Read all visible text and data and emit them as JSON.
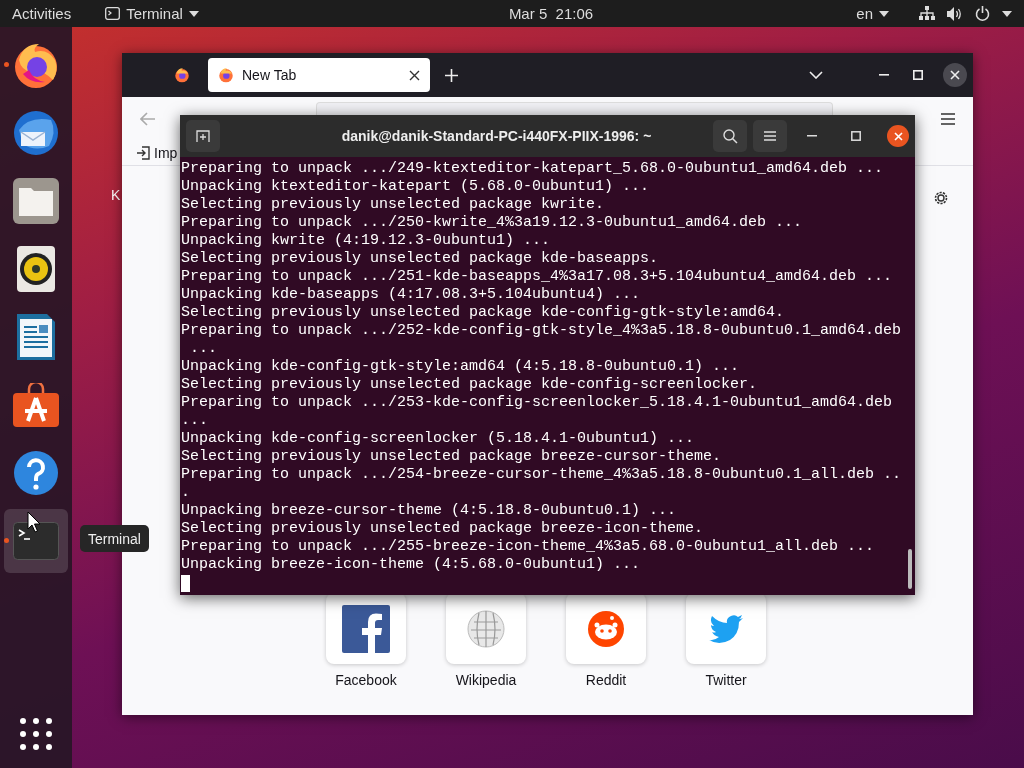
{
  "top_bar": {
    "activities": "Activities",
    "app_menu": "Terminal",
    "clock": "Mar 5  21:06",
    "input_source": "en"
  },
  "dock": {
    "items": [
      {
        "kind": "firefox",
        "running": true,
        "selected": false
      },
      {
        "kind": "thunderbird",
        "running": false,
        "selected": false
      },
      {
        "kind": "files",
        "running": false,
        "selected": false
      },
      {
        "kind": "rhythmbox",
        "running": false,
        "selected": false
      },
      {
        "kind": "writer",
        "running": false,
        "selected": false
      },
      {
        "kind": "software",
        "running": false,
        "selected": false
      },
      {
        "kind": "help",
        "running": false,
        "selected": false
      },
      {
        "kind": "terminal",
        "running": true,
        "selected": true
      }
    ],
    "tooltip": "Terminal"
  },
  "desktop_label": "K",
  "browser": {
    "tabs": [
      {
        "title": "New Tab",
        "selected": true
      }
    ],
    "bookmark": "Imp",
    "shortcuts": [
      {
        "label": "Facebook",
        "kind": "facebook"
      },
      {
        "label": "Wikipedia",
        "kind": "wikipedia"
      },
      {
        "label": "Reddit",
        "kind": "reddit"
      },
      {
        "label": "Twitter",
        "kind": "twitter"
      }
    ]
  },
  "terminal": {
    "title": "danik@danik-Standard-PC-i440FX-PIIX-1996: ~",
    "lines": [
      "Preparing to unpack .../249-ktexteditor-katepart_5.68.0-0ubuntu1_amd64.deb ...",
      "Unpacking ktexteditor-katepart (5.68.0-0ubuntu1) ...",
      "Selecting previously unselected package kwrite.",
      "Preparing to unpack .../250-kwrite_4%3a19.12.3-0ubuntu1_amd64.deb ...",
      "Unpacking kwrite (4:19.12.3-0ubuntu1) ...",
      "Selecting previously unselected package kde-baseapps.",
      "Preparing to unpack .../251-kde-baseapps_4%3a17.08.3+5.104ubuntu4_amd64.deb ...",
      "Unpacking kde-baseapps (4:17.08.3+5.104ubuntu4) ...",
      "Selecting previously unselected package kde-config-gtk-style:amd64.",
      "Preparing to unpack .../252-kde-config-gtk-style_4%3a5.18.8-0ubuntu0.1_amd64.deb",
      " ...",
      "Unpacking kde-config-gtk-style:amd64 (4:5.18.8-0ubuntu0.1) ...",
      "Selecting previously unselected package kde-config-screenlocker.",
      "Preparing to unpack .../253-kde-config-screenlocker_5.18.4.1-0ubuntu1_amd64.deb",
      "...",
      "Unpacking kde-config-screenlocker (5.18.4.1-0ubuntu1) ...",
      "Selecting previously unselected package breeze-cursor-theme.",
      "Preparing to unpack .../254-breeze-cursor-theme_4%3a5.18.8-0ubuntu0.1_all.deb ..",
      ".",
      "Unpacking breeze-cursor-theme (4:5.18.8-0ubuntu0.1) ...",
      "Selecting previously unselected package breeze-icon-theme.",
      "Preparing to unpack .../255-breeze-icon-theme_4%3a5.68.0-0ubuntu1_all.deb ...",
      "Unpacking breeze-icon-theme (4:5.68.0-0ubuntu1) ..."
    ]
  }
}
